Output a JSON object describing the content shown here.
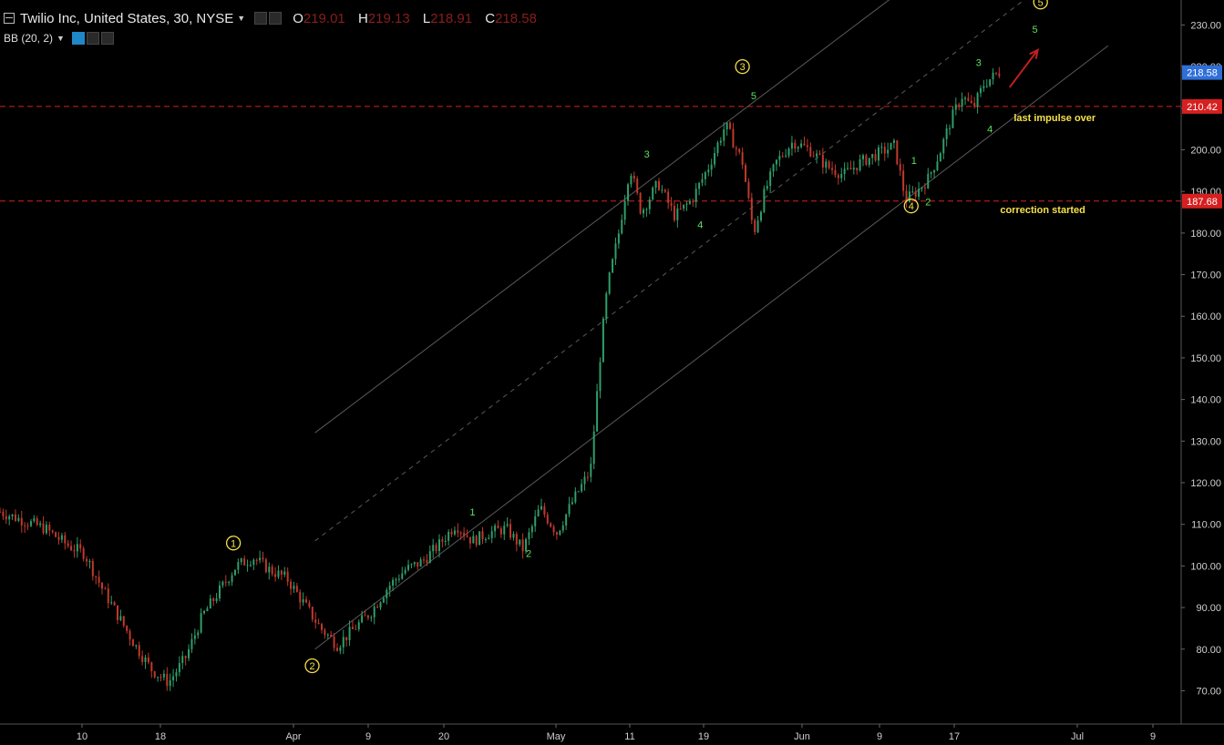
{
  "header": {
    "symbol": "Twilio Inc, United States, 30, NYSE",
    "ohlc": [
      {
        "key": "O",
        "value": "219.01"
      },
      {
        "key": "H",
        "value": "219.13"
      },
      {
        "key": "L",
        "value": "218.91"
      },
      {
        "key": "C",
        "value": "218.58"
      }
    ]
  },
  "indicator": {
    "label": "BB (20, 2)"
  },
  "colors": {
    "background": "#000000",
    "up_candle": "#2f9e6a",
    "down_candle": "#c0392b",
    "wave_major": "#f5e04a",
    "wave_minor": "#5be35b",
    "level_line": "#d62020",
    "price_tag_current": "#2f6fd8",
    "price_tag_level": "#d62020",
    "arrow": "#c41f1f"
  },
  "chart_data": {
    "type": "candlestick",
    "y_axis": {
      "range": [
        62,
        236
      ],
      "ticks": [
        70,
        80,
        90,
        100,
        110,
        120,
        130,
        140,
        150,
        160,
        170,
        180,
        190,
        200,
        210,
        220,
        230
      ],
      "tick_suffix": ".00",
      "position": "right"
    },
    "x_axis": {
      "ticks": [
        "10",
        "18",
        "Apr",
        "9",
        "20",
        "May",
        "11",
        "19",
        "Jun",
        "9",
        "17",
        "Jul",
        "9"
      ]
    },
    "price_tags": [
      {
        "value": 218.58,
        "text": "218.58",
        "kind": "current"
      },
      {
        "value": 210.42,
        "text": "210.42",
        "kind": "level"
      },
      {
        "value": 187.68,
        "text": "187.68",
        "kind": "level"
      }
    ],
    "horizontal_levels": [
      {
        "value": 210.42,
        "label": "last impulse over"
      },
      {
        "value": 187.68,
        "label": "correction started"
      }
    ],
    "price_path": [
      [
        0,
        113
      ],
      [
        8,
        109
      ],
      [
        12,
        105
      ],
      [
        15,
        103
      ],
      [
        18,
        95
      ],
      [
        21,
        88
      ],
      [
        24,
        81
      ],
      [
        27,
        75
      ],
      [
        30,
        72
      ],
      [
        33,
        78
      ],
      [
        36,
        88
      ],
      [
        39,
        94
      ],
      [
        42,
        100
      ],
      [
        45,
        102
      ],
      [
        48,
        99
      ],
      [
        51,
        97
      ],
      [
        54,
        91
      ],
      [
        57,
        85
      ],
      [
        60,
        81
      ],
      [
        63,
        85
      ],
      [
        66,
        89
      ],
      [
        69,
        95
      ],
      [
        72,
        99
      ],
      [
        75,
        101
      ],
      [
        78,
        105
      ],
      [
        81,
        110
      ],
      [
        84,
        106
      ],
      [
        87,
        108
      ],
      [
        90,
        109
      ],
      [
        93,
        104
      ],
      [
        96,
        114
      ],
      [
        99,
        108
      ],
      [
        102,
        116
      ],
      [
        105,
        123
      ],
      [
        107,
        155
      ],
      [
        108,
        167
      ],
      [
        110,
        180
      ],
      [
        112,
        196
      ],
      [
        114,
        185
      ],
      [
        117,
        192
      ],
      [
        120,
        184
      ],
      [
        123,
        188
      ],
      [
        126,
        196
      ],
      [
        129,
        206
      ],
      [
        132,
        197
      ],
      [
        134,
        180
      ],
      [
        136,
        190
      ],
      [
        138,
        197
      ],
      [
        141,
        202
      ],
      [
        144,
        200
      ],
      [
        147,
        196
      ],
      [
        150,
        194
      ],
      [
        153,
        197
      ],
      [
        156,
        199
      ],
      [
        159,
        201
      ],
      [
        161,
        188
      ],
      [
        163,
        190
      ],
      [
        165,
        193
      ],
      [
        167,
        199
      ],
      [
        169,
        207
      ],
      [
        171,
        213
      ],
      [
        173,
        210
      ],
      [
        175,
        216
      ],
      [
        178,
        219
      ]
    ],
    "x_range": [
      0,
      210
    ],
    "trend_channel": [
      {
        "from": [
          56,
          132
        ],
        "to": [
          160,
          238
        ],
        "style": "solid"
      },
      {
        "from": [
          56,
          106
        ],
        "to": [
          184,
          238
        ],
        "style": "dashed"
      },
      {
        "from": [
          56,
          80
        ],
        "to": [
          197,
          225
        ],
        "style": "solid"
      }
    ],
    "wave_labels": [
      {
        "text": "1",
        "x": 41.5,
        "y": 105.5,
        "kind": "major"
      },
      {
        "text": "2",
        "x": 55.5,
        "y": 76,
        "kind": "major"
      },
      {
        "text": "3",
        "x": 132,
        "y": 220,
        "kind": "major"
      },
      {
        "text": "4",
        "x": 162,
        "y": 186.5,
        "kind": "major"
      },
      {
        "text": "5",
        "x": 185,
        "y": 235.5,
        "kind": "major"
      },
      {
        "text": "1",
        "x": 84,
        "y": 113,
        "kind": "minor"
      },
      {
        "text": "2",
        "x": 94,
        "y": 103,
        "kind": "minor"
      },
      {
        "text": "3",
        "x": 115,
        "y": 199,
        "kind": "minor"
      },
      {
        "text": "4",
        "x": 124.5,
        "y": 182,
        "kind": "minor"
      },
      {
        "text": "5",
        "x": 134,
        "y": 213,
        "kind": "minor"
      },
      {
        "text": "1",
        "x": 162.5,
        "y": 197.5,
        "kind": "minor"
      },
      {
        "text": "2",
        "x": 165,
        "y": 187.5,
        "kind": "minor"
      },
      {
        "text": "3",
        "x": 174,
        "y": 221,
        "kind": "minor"
      },
      {
        "text": "4",
        "x": 176,
        "y": 205,
        "kind": "minor"
      },
      {
        "text": "5",
        "x": 184,
        "y": 229,
        "kind": "minor"
      }
    ],
    "arrow": {
      "from": [
        179.5,
        215
      ],
      "to": [
        184.5,
        224
      ]
    }
  }
}
